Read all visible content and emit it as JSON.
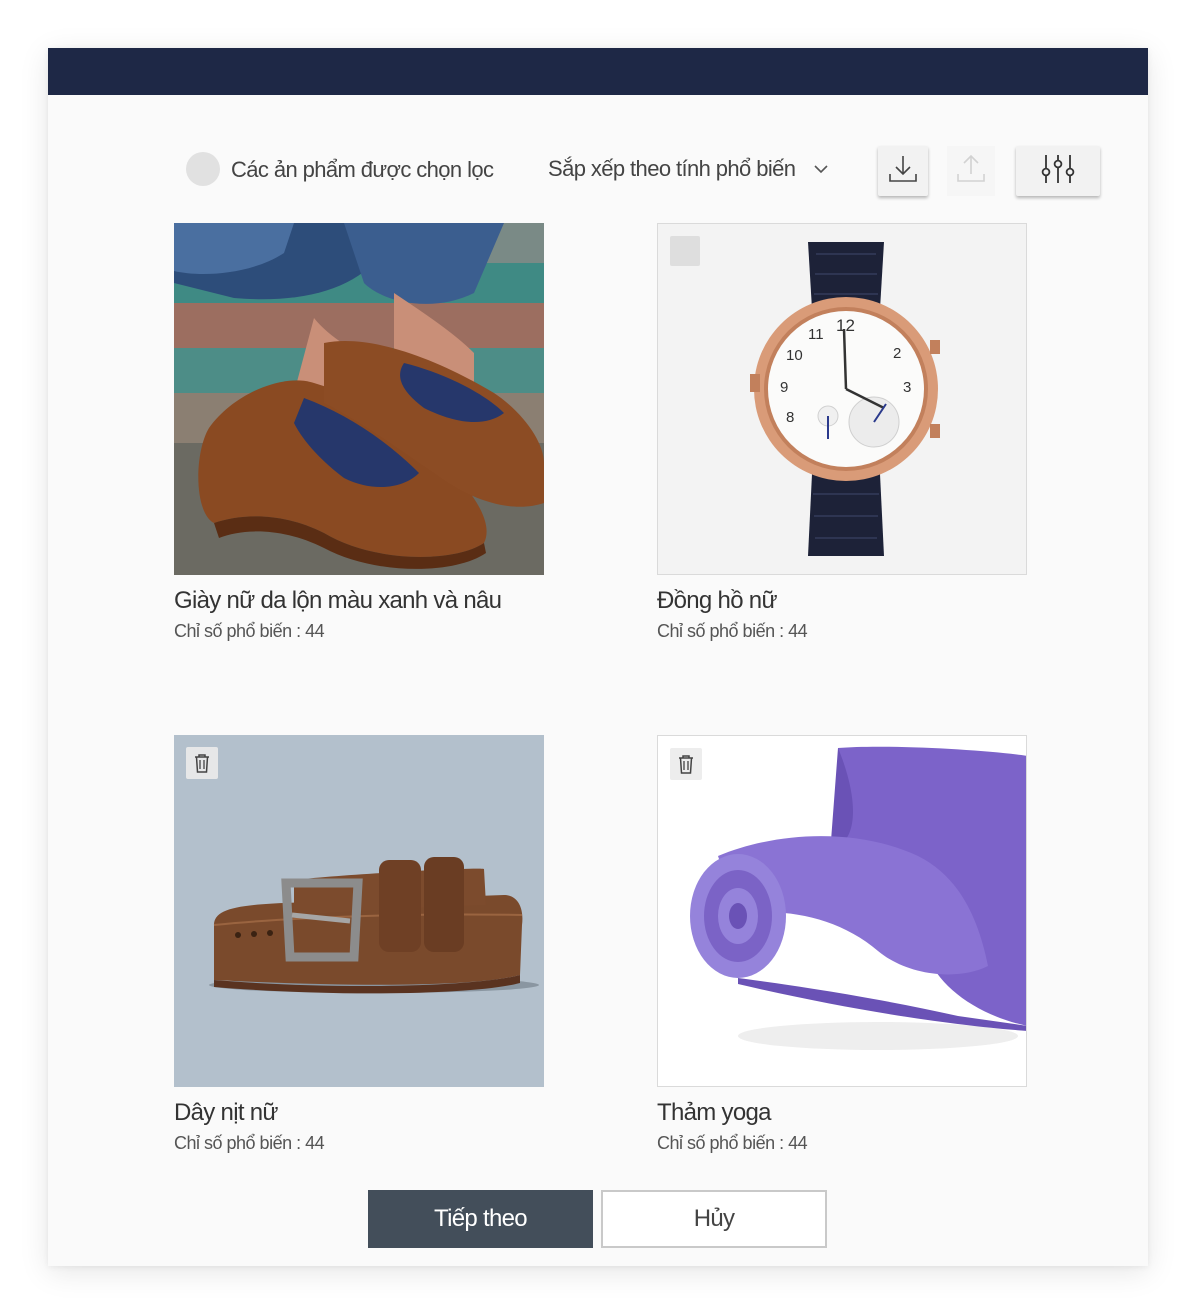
{
  "toolbar": {
    "curated_label": "Các ản phẩm được chọn lọc",
    "sort_label": "Sắp xếp theo tính phổ biến",
    "icons": {
      "sort": "chevron-down-icon",
      "download": "download-icon",
      "upload": "upload-icon",
      "filter": "sliders-icon"
    }
  },
  "products": [
    {
      "title": "Giày nữ da lộn màu xanh và nâu",
      "meta": "Chỉ số phổ biến : 44"
    },
    {
      "title": "Đồng hồ nữ",
      "meta": "Chỉ số phổ biến : 44"
    },
    {
      "title": "Dây nịt nữ",
      "meta": "Chỉ số phổ biến : 44"
    },
    {
      "title": "Thảm yoga",
      "meta": "Chỉ số phổ biến : 44"
    }
  ],
  "actions": {
    "next_label": "Tiếp theo",
    "cancel_label": "Hủy"
  },
  "colors": {
    "header": "#1e2846",
    "primary_button": "#434e5a",
    "background": "#fafafa"
  }
}
